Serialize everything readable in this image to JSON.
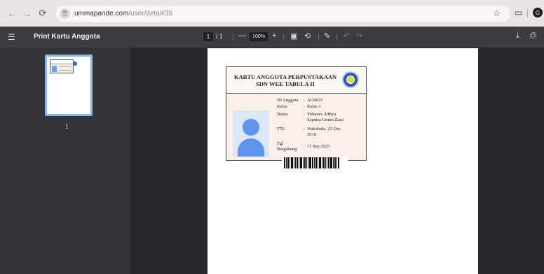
{
  "browser": {
    "url_host": "ummapande.com",
    "url_path": "/user/detail/35",
    "profile_initial": "G"
  },
  "pdf_toolbar": {
    "title": "Print Kartu Anggota",
    "current_page": "1",
    "page_total": "/ 1",
    "zoom": "100%"
  },
  "thumbnails": [
    {
      "page_number": "1"
    }
  ],
  "card": {
    "title_line1": "KARTU ANGGOTA PERPUSTAKAAN",
    "title_line2": "SDN WEE TABULA II",
    "fields": [
      {
        "label": "ID Anggota",
        "value": "AG0035"
      },
      {
        "label": "Kelas",
        "value": "Kelas 1"
      },
      {
        "label": "Nama",
        "value": "Yohanes Aditya Saputra Umbu Zaza"
      },
      {
        "label": "TTL",
        "value": "Waitabula, 23 Des 2018"
      },
      {
        "label": "Tgl Bergabung",
        "value": "11 Sep 2025"
      }
    ]
  },
  "icons": {
    "back": "arrow-left-icon",
    "forward": "arrow-right-icon",
    "reload": "reload-icon",
    "menu": "hamburger-icon",
    "download": "download-icon",
    "print": "print-icon"
  }
}
